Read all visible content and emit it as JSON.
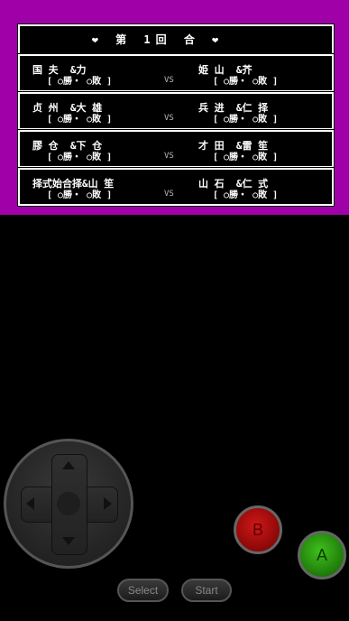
{
  "title": "❤ 第 1回 合 ❤",
  "vs_label": "VS",
  "matches": [
    {
      "left_team": "国 夫  &力",
      "left_record": "[ ○勝・ ○敗 ]",
      "right_team": "姫 山  &芥",
      "right_record": "[ ○勝・ ○敗 ]"
    },
    {
      "left_team": "贞 州  &大 雄",
      "left_record": "[ ○勝・ ○敗 ]",
      "right_team": "兵 进  &仁 择",
      "right_record": "[ ○勝・ ○敗 ]"
    },
    {
      "left_team": "膠 仓  &下 仓",
      "left_record": "[ ○勝・ ○敗 ]",
      "right_team": "才 田  &雷 笙",
      "right_record": "[ ○勝・ ○敗 ]"
    },
    {
      "left_team": "择式始合择&山 笙",
      "left_record": "[ ○勝・ ○敗 ]",
      "right_team": "山 石  &仁 式",
      "right_record": "[ ○勝・ ○敗 ]"
    }
  ],
  "controls": {
    "select_label": "Select",
    "start_label": "Start",
    "a_label": "A",
    "b_label": "B"
  },
  "colors": {
    "screen_bg": "#a000a8",
    "a_button": "#2e9a14",
    "b_button": "#b01010"
  }
}
